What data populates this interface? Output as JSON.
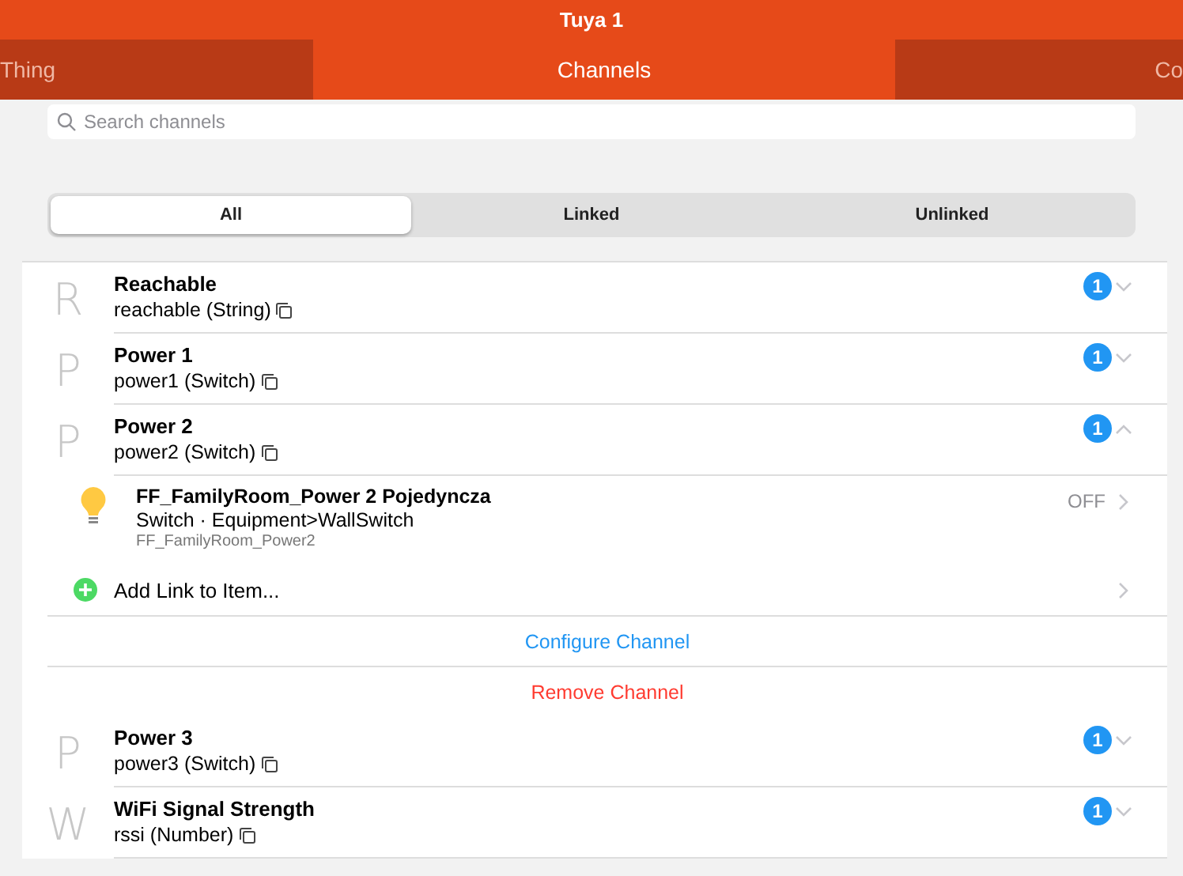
{
  "window": {
    "title": "Tuya 1"
  },
  "tabs": [
    {
      "label": "Thing",
      "selected": false
    },
    {
      "label": "Channels",
      "selected": true
    },
    {
      "label": "Co",
      "selected": false
    }
  ],
  "search": {
    "placeholder": "Search channels"
  },
  "filters": [
    {
      "label": "All",
      "selected": true
    },
    {
      "label": "Linked",
      "selected": false
    },
    {
      "label": "Unlinked",
      "selected": false
    }
  ],
  "channels": [
    {
      "letter": "R",
      "label": "Reachable",
      "id_type": "reachable (String)",
      "badge": "1",
      "expanded": false
    },
    {
      "letter": "P",
      "label": "Power 1",
      "id_type": "power1 (Switch)",
      "badge": "1",
      "expanded": false
    },
    {
      "letter": "P",
      "label": "Power 2",
      "id_type": "power2 (Switch)",
      "badge": "1",
      "expanded": true,
      "links": [
        {
          "label": "FF_FamilyRoom_Power 2 Pojedyncza",
          "type": "Switch · Equipment>WallSwitch",
          "name": "FF_FamilyRoom_Power2",
          "state": "OFF"
        }
      ],
      "add_link": "Add Link to Item...",
      "configure": "Configure Channel",
      "remove": "Remove Channel"
    },
    {
      "letter": "P",
      "label": "Power 3",
      "id_type": "power3 (Switch)",
      "badge": "1",
      "expanded": false
    },
    {
      "letter": "W",
      "label": "WiFi Signal Strength",
      "id_type": "rssi (Number)",
      "badge": "1",
      "expanded": false
    }
  ]
}
